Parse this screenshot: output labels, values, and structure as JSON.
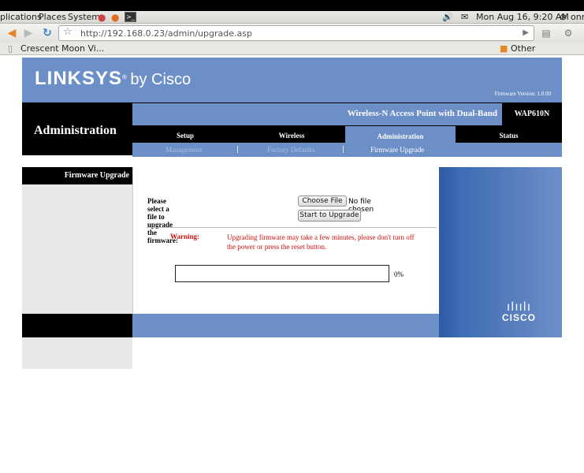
{
  "gnome_panel": {
    "menus": [
      "plications",
      "Places",
      "System"
    ],
    "clock": "Mon Aug 16,  9:20 AM",
    "user": "onr"
  },
  "browser": {
    "url": "http://192.168.0.23/admin/upgrade.asp",
    "bookmarks": [
      "Crescent Moon Vi...",
      "Other Bookmarks"
    ]
  },
  "router": {
    "brand": "LINKSYS",
    "brand_suffix": "by Cisco",
    "firmware_version": "Firmware Version: 1.0.00",
    "section": "Administration",
    "product_name": "Wireless-N Access Point with Dual-Band",
    "model": "WAP610N",
    "tabs": [
      "Setup",
      "Wireless",
      "Administration",
      "Status"
    ],
    "subtabs": [
      "Management",
      "Factory Defaults",
      "Firmware Upgrade"
    ],
    "subtab_separator": "|",
    "left_title": "Firmware Upgrade",
    "select_label": "Please select a file to upgrade the firmware:",
    "choose_file": "Choose File",
    "no_file": "No file chosen",
    "start_upgrade": "Start to Upgrade",
    "warning_label": "Warning:",
    "warning_text": "Upgrading firmware may take a few minutes, please don't turn off the power or press the reset button.",
    "progress_percent": "0%",
    "progress_value": 0,
    "cisco_word": "CISCO",
    "accent_color": "#6d8fc8",
    "warning_color": "#d01010"
  }
}
